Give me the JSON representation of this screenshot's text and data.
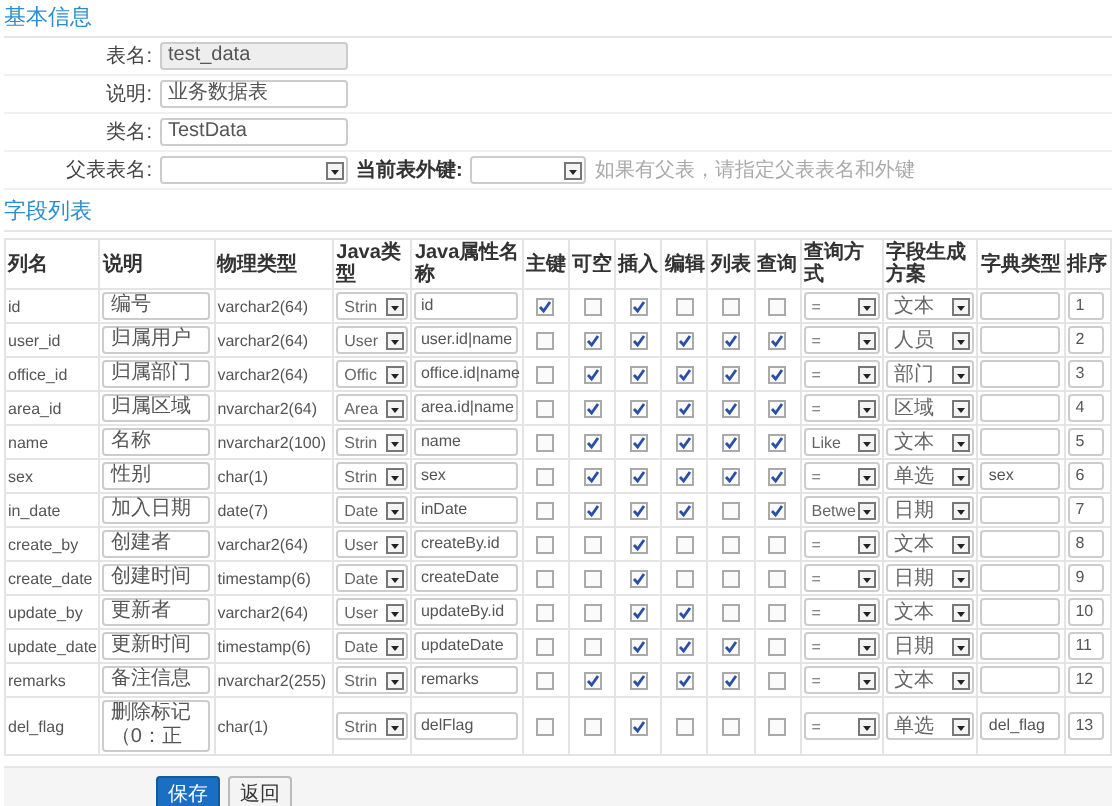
{
  "basic_info": {
    "title": "基本信息",
    "fields": [
      {
        "label": "表名:",
        "value": "test_data",
        "readonly": true
      },
      {
        "label": "说明:",
        "value": "业务数据表",
        "readonly": false
      },
      {
        "label": "类名:",
        "value": "TestData",
        "readonly": false
      }
    ],
    "parent": {
      "label": "父表表名:",
      "fk_label": "当前表外键:",
      "hint": "如果有父表，请指定父表表名和外键"
    }
  },
  "field_list": {
    "title": "字段列表",
    "columns": [
      "列名",
      "说明",
      "物理类型",
      "Java类型",
      "Java属性名称",
      "主键",
      "可空",
      "插入",
      "编辑",
      "列表",
      "查询",
      "查询方式",
      "字段生成方案",
      "字典类型",
      "排序"
    ],
    "rows": [
      {
        "name": "id",
        "comment": "编号",
        "jdbc_type": "varchar2(64)",
        "java_type": "Strin",
        "java_field": "id",
        "checks": [
          true,
          false,
          true,
          false,
          false,
          false
        ],
        "query_type": "=",
        "show_type": "文本",
        "dict_type": "",
        "sort": "1"
      },
      {
        "name": "user_id",
        "comment": "归属用户",
        "jdbc_type": "varchar2(64)",
        "java_type": "User",
        "java_field": "user.id|name",
        "checks": [
          false,
          true,
          true,
          true,
          true,
          true
        ],
        "query_type": "=",
        "show_type": "人员",
        "dict_type": "",
        "sort": "2"
      },
      {
        "name": "office_id",
        "comment": "归属部门",
        "jdbc_type": "varchar2(64)",
        "java_type": "Offic",
        "java_field": "office.id|name",
        "checks": [
          false,
          true,
          true,
          true,
          true,
          true
        ],
        "query_type": "=",
        "show_type": "部门",
        "dict_type": "",
        "sort": "3"
      },
      {
        "name": "area_id",
        "comment": "归属区域",
        "jdbc_type": "nvarchar2(64)",
        "java_type": "Area",
        "java_field": "area.id|name",
        "checks": [
          false,
          true,
          true,
          true,
          true,
          true
        ],
        "query_type": "=",
        "show_type": "区域",
        "dict_type": "",
        "sort": "4"
      },
      {
        "name": "name",
        "comment": "名称",
        "jdbc_type": "nvarchar2(100)",
        "java_type": "Strin",
        "java_field": "name",
        "checks": [
          false,
          true,
          true,
          true,
          true,
          true
        ],
        "query_type": "Like",
        "show_type": "文本",
        "dict_type": "",
        "sort": "5"
      },
      {
        "name": "sex",
        "comment": "性别",
        "jdbc_type": "char(1)",
        "java_type": "Strin",
        "java_field": "sex",
        "checks": [
          false,
          true,
          true,
          true,
          true,
          true
        ],
        "query_type": "=",
        "show_type": "单选",
        "dict_type": "sex",
        "sort": "6"
      },
      {
        "name": "in_date",
        "comment": "加入日期",
        "jdbc_type": "date(7)",
        "java_type": "Date",
        "java_field": "inDate",
        "checks": [
          false,
          true,
          true,
          true,
          false,
          true
        ],
        "query_type": "Betwe",
        "show_type": "日期",
        "dict_type": "",
        "sort": "7"
      },
      {
        "name": "create_by",
        "comment": "创建者",
        "jdbc_type": "varchar2(64)",
        "java_type": "User",
        "java_field": "createBy.id",
        "checks": [
          false,
          false,
          true,
          false,
          false,
          false
        ],
        "query_type": "=",
        "show_type": "文本",
        "dict_type": "",
        "sort": "8"
      },
      {
        "name": "create_date",
        "comment": "创建时间",
        "jdbc_type": "timestamp(6)",
        "java_type": "Date",
        "java_field": "createDate",
        "checks": [
          false,
          false,
          true,
          false,
          false,
          false
        ],
        "query_type": "=",
        "show_type": "日期",
        "dict_type": "",
        "sort": "9"
      },
      {
        "name": "update_by",
        "comment": "更新者",
        "jdbc_type": "varchar2(64)",
        "java_type": "User",
        "java_field": "updateBy.id",
        "checks": [
          false,
          false,
          true,
          true,
          false,
          false
        ],
        "query_type": "=",
        "show_type": "文本",
        "dict_type": "",
        "sort": "10"
      },
      {
        "name": "update_date",
        "comment": "更新时间",
        "jdbc_type": "timestamp(6)",
        "java_type": "Date",
        "java_field": "updateDate",
        "checks": [
          false,
          false,
          true,
          true,
          true,
          false
        ],
        "query_type": "=",
        "show_type": "日期",
        "dict_type": "",
        "sort": "11"
      },
      {
        "name": "remarks",
        "comment": "备注信息",
        "jdbc_type": "nvarchar2(255)",
        "java_type": "Strin",
        "java_field": "remarks",
        "checks": [
          false,
          true,
          true,
          true,
          true,
          false
        ],
        "query_type": "=",
        "show_type": "文本",
        "dict_type": "",
        "sort": "12"
      },
      {
        "name": "del_flag",
        "comment": "删除标记（0：正",
        "jdbc_type": "char(1)",
        "java_type": "Strin",
        "java_field": "delFlag",
        "checks": [
          false,
          false,
          true,
          false,
          false,
          false
        ],
        "query_type": "=",
        "show_type": "单选",
        "dict_type": "del_flag",
        "sort": "13"
      }
    ]
  },
  "buttons": [
    {
      "label": "保存",
      "kind": "primary"
    },
    {
      "label": "返回",
      "kind": "default"
    }
  ]
}
